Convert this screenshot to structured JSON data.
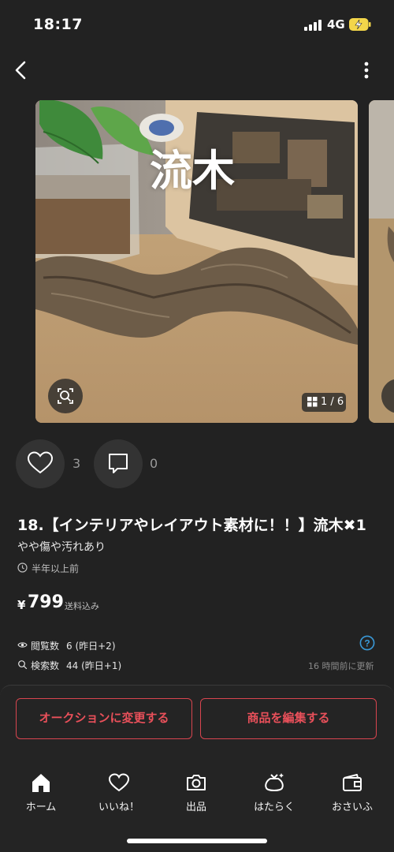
{
  "status_bar": {
    "time": "18:17",
    "network": "4G"
  },
  "gallery": {
    "caption": "流木",
    "counter": "1 / 6"
  },
  "engagement": {
    "likes": "3",
    "comments": "0"
  },
  "item": {
    "title": "18.【インテリアやレイアウト素材に！！】流木✖1",
    "condition": "やや傷や汚れあり",
    "listed_ago": "半年以上前",
    "currency": "¥",
    "price": "799",
    "shipping_note": "送料込み"
  },
  "stats": {
    "views_label": "閲覧数",
    "views_value": "6 (昨日+2)",
    "searches_label": "検索数",
    "searches_value": "44 (昨日+1)",
    "updated": "16 時間前に更新"
  },
  "actions": {
    "auction": "オークションに変更する",
    "edit": "商品を編集する"
  },
  "tabs": [
    "ホーム",
    "いいね！",
    "出品",
    "はたらく",
    "おさいふ"
  ],
  "colors": {
    "accent": "#e9505a",
    "background": "#222222",
    "help": "#3a9ad9"
  }
}
